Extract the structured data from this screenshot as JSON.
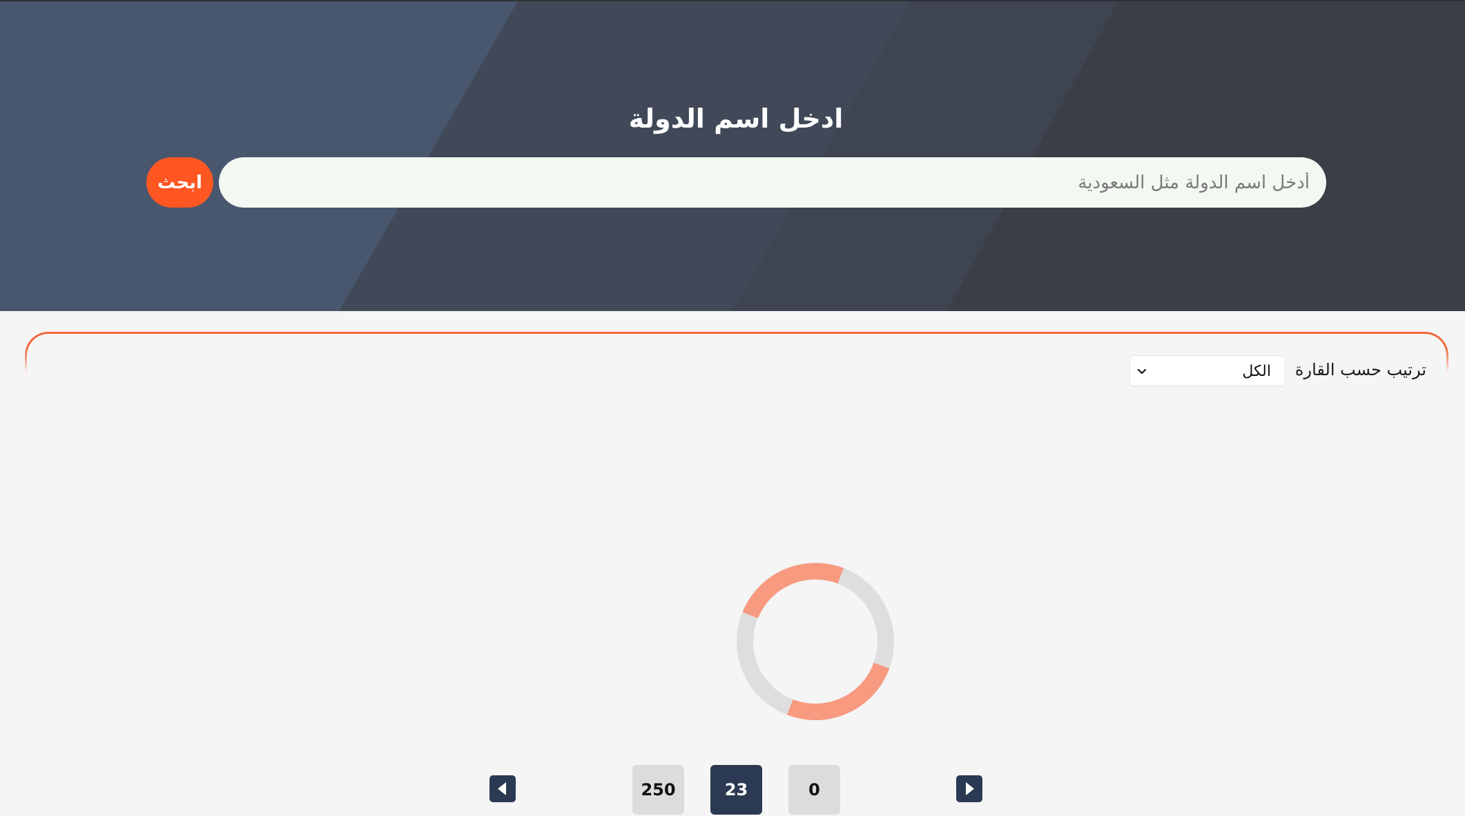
{
  "hero": {
    "title": "ادخل اسم الدولة",
    "search_placeholder": "أدخل اسم الدولة مثل السعودية",
    "search_button_label": "ابحث"
  },
  "filter": {
    "label": "ترتيب حسب القارة",
    "selected_option": "الكل"
  },
  "loader": {
    "track_color": "#dcdcdc",
    "accent_color": "#f89a80"
  },
  "pagination": {
    "total": "250",
    "current": "23",
    "start": "0"
  },
  "colors": {
    "accent": "#ff5622",
    "navy": "#2b3a52",
    "hero_dark": "#3b4049",
    "hero_blue": "#48576e"
  }
}
